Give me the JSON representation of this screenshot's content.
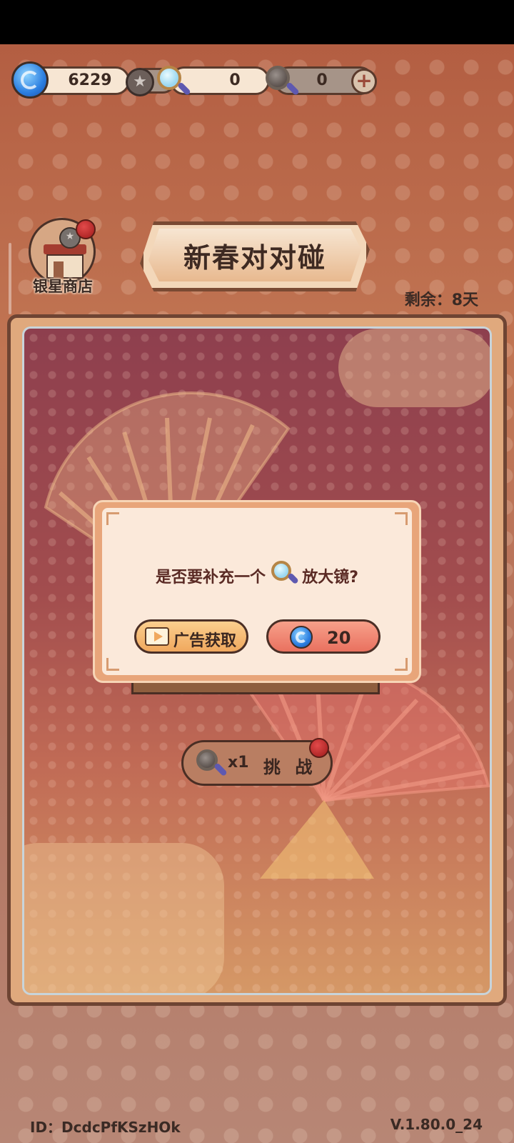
{
  "resources": {
    "coins": "6229",
    "magnifier_count": "0",
    "dark_magnifier_count": "0"
  },
  "shop": {
    "label": "银星商店"
  },
  "event": {
    "title": "新春对对碰",
    "remaining": "剩余：8天"
  },
  "challenge": {
    "multiplier": "x1",
    "label": "挑 战"
  },
  "dialog": {
    "question_prefix": "是否要补充一个",
    "question_suffix": "放大镜?",
    "ad_button": "广告获取",
    "buy_price": "20"
  },
  "footer": {
    "id": "ID：DcdcPfKSzHOk",
    "version": "V.1.80.0_24"
  },
  "icons": {
    "coin": "swirl-coin-icon",
    "star": "silver-star-icon",
    "magnifier": "magnifier-icon",
    "play": "play-video-icon",
    "add": "plus-icon",
    "shop": "shop-icon"
  },
  "colors": {
    "accent": "#e9715f",
    "gold": "#f0a85e",
    "text": "#3a2620"
  }
}
